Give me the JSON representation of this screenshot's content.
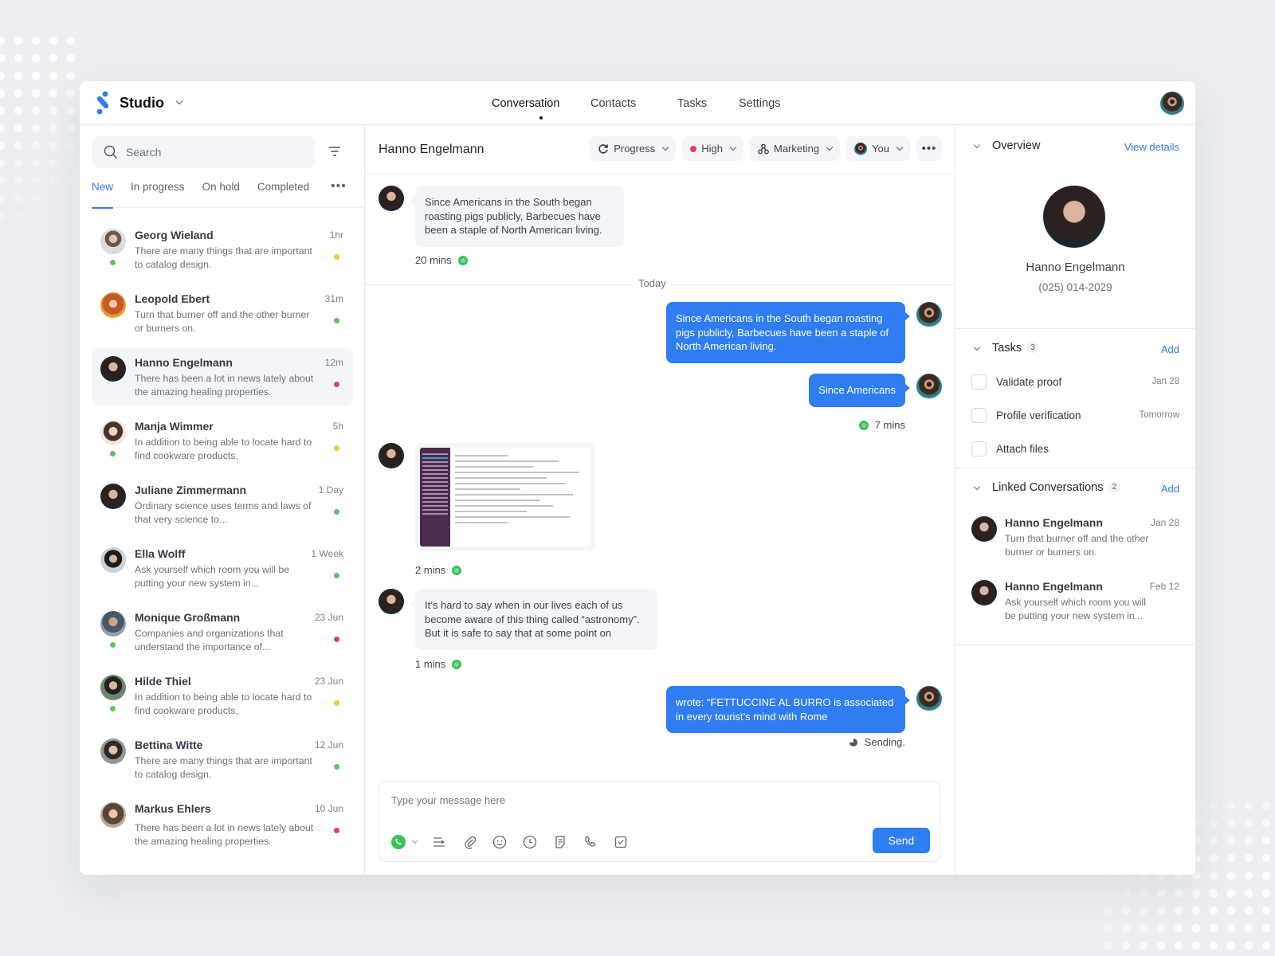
{
  "app": {
    "name": "Studio"
  },
  "nav": [
    {
      "label": "Conversation",
      "active": true
    },
    {
      "label": "Contacts",
      "active": false
    },
    {
      "label": "Tasks",
      "active": false
    },
    {
      "label": "Settings",
      "active": false
    }
  ],
  "sidebar": {
    "search_placeholder": "Search",
    "tabs": [
      "New",
      "In progress",
      "On hold",
      "Completed"
    ],
    "conversations": [
      {
        "name": "Georg Wieland",
        "time": "1hr",
        "preview": "There are many things that are important to catalog design.",
        "online": true,
        "priority_color": "#f4c542"
      },
      {
        "name": "Leopold Ebert",
        "time": "31m",
        "preview": "Turn that burner off and the other burner or burners on.",
        "online": false,
        "priority_color": "#5ac65a"
      },
      {
        "name": "Hanno Engelmann",
        "time": "12m",
        "preview": "There has been a lot in news lately about the amazing healing properties.",
        "online": false,
        "priority_color": "#e0405a",
        "selected": true
      },
      {
        "name": "Manja Wimmer",
        "time": "5h",
        "preview": "In addition to being able to locate hard to find cookware products,",
        "online": true,
        "priority_color": "#f4c542"
      },
      {
        "name": "Juliane Zimmermann",
        "time": "1 Day",
        "preview": "Ordinary science uses terms and laws of that very science to...",
        "online": false,
        "priority_color": "#5ac65a"
      },
      {
        "name": "Ella Wolff",
        "time": "1 Week",
        "preview": "Ask yourself which room you will be putting your new system in...",
        "online": false,
        "priority_color": "#5ac65a"
      },
      {
        "name": "Monique Großmann",
        "time": "23 Jun",
        "preview": "Companies and organizations that understand the importance of...",
        "online": true,
        "priority_color": "#e0405a"
      },
      {
        "name": "Hilde Thiel",
        "time": "23 Jun",
        "preview": "In addition to being able to locate hard to find cookware products,",
        "online": true,
        "priority_color": "#f4c542"
      },
      {
        "name": "Bettina Witte",
        "time": "12 Jun",
        "preview": "There are many things that are important to catalog design.",
        "online": false,
        "priority_color": "#5ac65a"
      },
      {
        "name": "Markus Ehlers",
        "time": "10 Jun",
        "preview": "There has been a lot in news lately about the amazing healing properties.",
        "online": false,
        "priority_color": "#e0405a"
      }
    ]
  },
  "chat": {
    "contact_name": "Hanno Engelmann",
    "chips": {
      "status": "Progress",
      "priority": "High",
      "team": "Marketing",
      "assignee": "You"
    },
    "messages": {
      "m1": {
        "text": "Since Americans in the South began roasting pigs publicly, Barbecues have been a staple of North American living.",
        "time": "20 mins"
      },
      "divider": "Today",
      "m2": {
        "text": "Since Americans in the South began roasting pigs publicly, Barbecues have been a staple of North American living."
      },
      "m3": {
        "text": "Since Americans",
        "time": "7 mins"
      },
      "m4": {
        "time": "2 mins"
      },
      "m5": {
        "text": "It’s hard to say when in our lives each of us become aware of this thing called “astronomy”. But it is safe to say that at some point on",
        "time": "1 mins"
      },
      "m6": {
        "text": "wrote: “FETTUCCINE AL BURRO is associated in every tourist’s mind with Rome",
        "status": "Sending."
      }
    },
    "composer": {
      "placeholder": "Type your message here",
      "send_label": "Send"
    }
  },
  "details": {
    "overview": {
      "title": "Overview",
      "link": "View details",
      "name": "Hanno Engelmann",
      "phone": "(025) 014-2029"
    },
    "tasks": {
      "title": "Tasks",
      "count": "3",
      "add": "Add",
      "items": [
        {
          "label": "Validate proof",
          "due": "Jan 28"
        },
        {
          "label": "Profile verification",
          "due": "Tomorrow"
        },
        {
          "label": "Attach files",
          "due": ""
        }
      ]
    },
    "linked": {
      "title": "Linked Conversations",
      "count": "2",
      "add": "Add",
      "items": [
        {
          "name": "Hanno Engelmann",
          "date": "Jan 28",
          "preview": "Turn that burner off and the other burner or burners on."
        },
        {
          "name": "Hanno Engelmann",
          "date": "Feb 12",
          "preview": "Ask yourself which room you will be putting your new system in..."
        }
      ]
    }
  },
  "colors": {
    "accent": "#2f7df0",
    "link": "#3478e5",
    "online": "#5ac65a",
    "whatsapp": "#39c15a"
  }
}
